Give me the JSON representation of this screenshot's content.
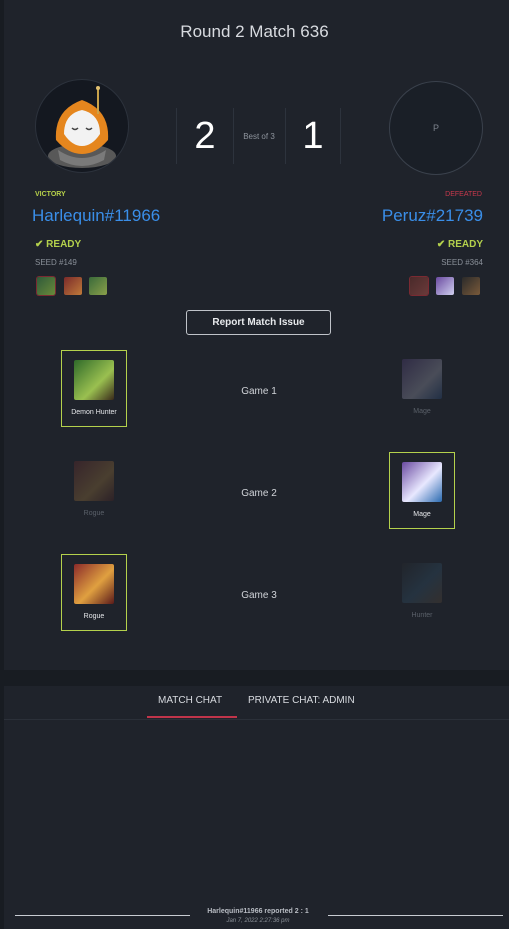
{
  "title": "Round 2 Match 636",
  "score": {
    "left": "2",
    "right": "1",
    "best_of": "Best of 3"
  },
  "players": {
    "left": {
      "result": "VICTORY",
      "name": "Harlequin#11966",
      "status": "READY",
      "seed": "SEED #149"
    },
    "right": {
      "result": "DEFEATED",
      "name": "Peruz#21739",
      "status": "READY",
      "seed": "SEED #364",
      "avatar_letter": "P"
    }
  },
  "report_button": "Report Match Issue",
  "games": [
    {
      "label": "Game 1",
      "left": "Demon Hunter",
      "right": "Mage"
    },
    {
      "label": "Game 2",
      "left": "Rogue",
      "right": "Mage"
    },
    {
      "label": "Game 3",
      "left": "Rogue",
      "right": "Hunter"
    }
  ],
  "chat_tabs": [
    "MATCH CHAT",
    "PRIVATE CHAT: ADMIN"
  ],
  "report_note": "Harlequin#11966 reported 2 : 1",
  "report_time": "Jan 7, 2022 2:27:36 pm",
  "colors": {
    "accent_green": "#b4d14c",
    "link_blue": "#3a8ee8",
    "defeat_red": "#c8384c",
    "tab_red": "#c0344a"
  },
  "icons": {
    "check": "check-icon"
  }
}
